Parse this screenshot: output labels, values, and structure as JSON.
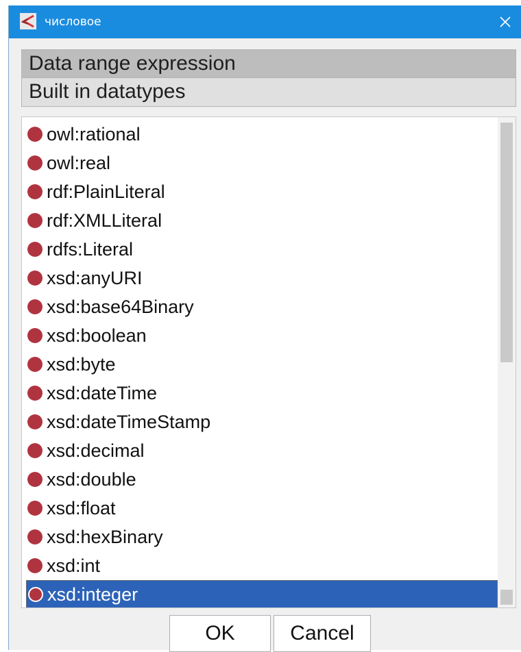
{
  "window": {
    "title": "числовое",
    "icon": "protege-app-icon",
    "close_icon": "close-icon"
  },
  "tabs": [
    {
      "label": "Data range expression",
      "active": true
    },
    {
      "label": "Built in datatypes",
      "active": false
    }
  ],
  "datatypes": {
    "items": [
      {
        "label": "owl:rational"
      },
      {
        "label": "owl:real"
      },
      {
        "label": "rdf:PlainLiteral"
      },
      {
        "label": "rdf:XMLLiteral"
      },
      {
        "label": "rdfs:Literal"
      },
      {
        "label": "xsd:anyURI"
      },
      {
        "label": "xsd:base64Binary"
      },
      {
        "label": "xsd:boolean"
      },
      {
        "label": "xsd:byte"
      },
      {
        "label": "xsd:dateTime"
      },
      {
        "label": "xsd:dateTimeStamp"
      },
      {
        "label": "xsd:decimal"
      },
      {
        "label": "xsd:double"
      },
      {
        "label": "xsd:float"
      },
      {
        "label": "xsd:hexBinary"
      },
      {
        "label": "xsd:int"
      },
      {
        "label": "xsd:integer",
        "selected": true
      }
    ],
    "item_icon": "datatype-dot-icon",
    "accent_color": "#2c63b8",
    "dot_color": "#b03440"
  },
  "buttons": {
    "ok_label": "OK",
    "cancel_label": "Cancel"
  }
}
